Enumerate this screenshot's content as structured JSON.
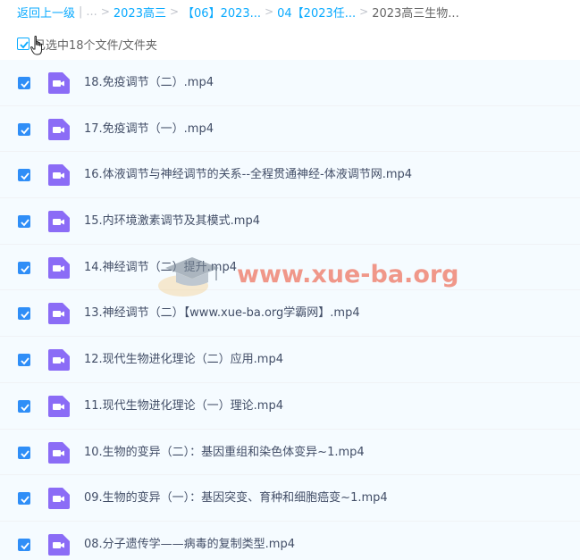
{
  "breadcrumb": {
    "back_label": "返回上一级",
    "ellipsis": "...",
    "items": [
      {
        "label": "2023高三"
      },
      {
        "label": "【06】2023..."
      },
      {
        "label": "04【2023任..."
      }
    ],
    "current": "2023高三生物..."
  },
  "selection": {
    "label": "已选中18个文件/文件夹"
  },
  "files": [
    {
      "name": "18.免疫调节（二）.mp4",
      "icon": "video-icon"
    },
    {
      "name": "17.免疫调节（一）.mp4",
      "icon": "video-icon"
    },
    {
      "name": "16.体液调节与神经调节的关系--全程贯通神经-体液调节网.mp4",
      "icon": "video-icon"
    },
    {
      "name": "15.内环境激素调节及其模式.mp4",
      "icon": "video-icon"
    },
    {
      "name": "14.神经调节（二）提升.mp4",
      "icon": "video-icon"
    },
    {
      "name": "13.神经调节（二）【www.xue-ba.org学霸网】.mp4",
      "icon": "video-icon"
    },
    {
      "name": "12.现代生物进化理论（二）应用.mp4",
      "icon": "video-icon"
    },
    {
      "name": "11.现代生物进化理论（一）理论.mp4",
      "icon": "video-icon"
    },
    {
      "name": "10.生物的变异（二）：基因重组和染色体变异~1.mp4",
      "icon": "video-icon"
    },
    {
      "name": "09.生物的变异（一）：基因突变、育种和细胞癌变~1.mp4",
      "icon": "video-icon"
    },
    {
      "name": "08.分子遗传学——病毒的复制类型.mp4",
      "icon": "video-icon"
    }
  ],
  "watermark": {
    "text": "www.xue-ba.org"
  },
  "colors": {
    "accent": "#09aaff",
    "checkbox": "#2f8ef7",
    "video_icon": "#8b6cf6",
    "row_bg": "#f5fbff"
  }
}
